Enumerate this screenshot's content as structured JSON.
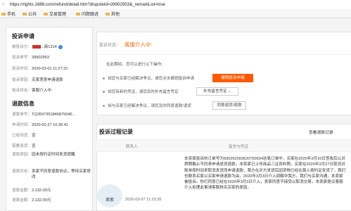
{
  "browser": {
    "nav_glyph": "←",
    "url": "https://rights.1688.com/refund/detail.htm?disputeId=28902953&_remarkList=true"
  },
  "bookmarks": [
    {
      "label": "手机"
    },
    {
      "label": "公共"
    },
    {
      "label": "交易管理"
    },
    {
      "label": "问题跟进"
    },
    {
      "label": "其他"
    }
  ],
  "left": {
    "title": "投诉申请",
    "rows": [
      {
        "k": "被投诉方：",
        "v": "...商1314"
      },
      {
        "k": "投诉单号：",
        "v": "28902953"
      },
      {
        "k": "投诉时间：",
        "v": "2020-03-01 11:27:31"
      },
      {
        "k": "投诉原因：",
        "v": "买家恶意申请退款"
      },
      {
        "k": "投诉状态：",
        "v": "客服介入中"
      }
    ],
    "refund_title": "退款信息",
    "refund_rows": [
      {
        "k": "退款单号：",
        "v": "TQ3597351846875040..."
      },
      {
        "k": "申请时间：",
        "v": "2020-02-27 10:30:41"
      },
      {
        "k": "已收到货：",
        "v": "否"
      },
      {
        "k": "需要退货：",
        "v": "否"
      },
      {
        "k": "退款原因：",
        "v": "因未按约定时间发货提醒"
      },
      {
        "k": "退款状态：",
        "v": "卖家不同意退款协议，等待买家修改"
      },
      {
        "k": "退款金额：",
        "v": "2,132.00元"
      },
      {
        "k": "退款金额：",
        "v": "2,132.00元"
      }
    ]
  },
  "case": {
    "status_label": "投诉状态：",
    "status_value": "客服介入中",
    "tip": "在此期间，您可以进行以下操作：",
    "opt1": "如您与买家已经解决争议，请您点击撤销投诉申请",
    "opt2": "如您有新的凭证，请您及时补充留言凭证",
    "opt3": "如与买家已经解决争议，请您及时同意退款/退货",
    "btn_withdraw": "撤销投诉申请",
    "btn_supplement": "补充留言凭证",
    "btn_agree": "同意退货/退款"
  },
  "history": {
    "title": "投诉过程记录",
    "link": "查看退款记录",
    "col1": "联系人",
    "col2": "留言与凭证",
    "desc": "本卖家投诉的订单号为590262093520750504这笔订单中，买家在2020年2月10日签收后以对质期截止不同来申请退货退款，本卖家已上传商品三证资料照，买家在2020年2月27日取消对账单按时间来取消发货而申请退款，我方在对方发货后因货物已经在路上按约定发货了，我们也联系买家以买家申请退款为由，2020年3月3日介入调解中我方，我们与买家沟通，本卖家被投诉。你们同意已经在2020年3月3日介入，卖家同意不接受以取消交易，本卖家提议客服介入处理此事请客服核实买家的原因。",
    "role": "卖家",
    "date": "2020-03-07 11:23:35"
  }
}
